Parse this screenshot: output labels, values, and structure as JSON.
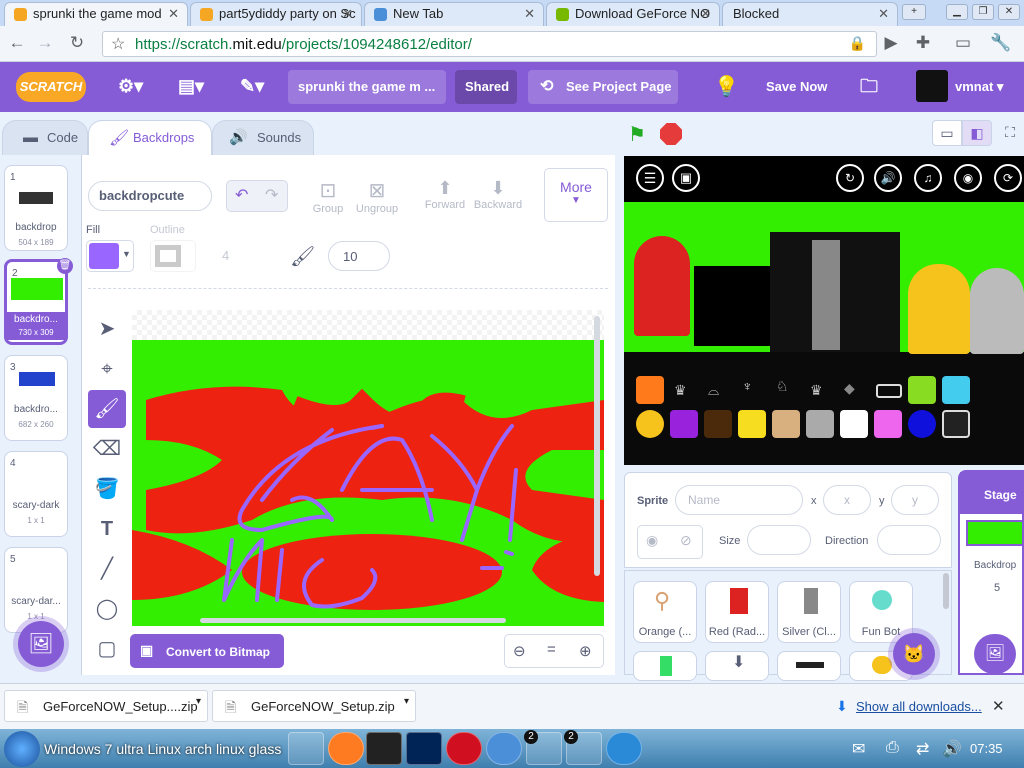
{
  "browser": {
    "tabs": [
      {
        "title": "sprunki the game mod"
      },
      {
        "title": "part5ydiddy party on Sc"
      },
      {
        "title": "New Tab"
      },
      {
        "title": "Download GeForce NO"
      },
      {
        "title": "Blocked"
      }
    ],
    "url_prefix": "https://scratch.",
    "url_domain": "mit.edu",
    "url_path": "/projects/1094248612/editor/"
  },
  "menubar": {
    "logo": "SCRATCH",
    "project_title": "sprunki the game m ...",
    "shared_label": "Shared",
    "see_project_label": "See Project Page",
    "save_label": "Save Now",
    "username": "vmnat"
  },
  "editor_tabs": {
    "code": "Code",
    "backdrops": "Backdrops",
    "sounds": "Sounds"
  },
  "backdrops": [
    {
      "num": "1",
      "name": "backdrop",
      "size": "504 x 189"
    },
    {
      "num": "2",
      "name": "backdro...",
      "size": "730 x 309"
    },
    {
      "num": "3",
      "name": "backdro...",
      "size": "682 x 260"
    },
    {
      "num": "4",
      "name": "scary-dark",
      "size": "1 x 1"
    },
    {
      "num": "5",
      "name": "scary-dar...",
      "size": "1 x 1"
    }
  ],
  "paint": {
    "costume_name": "backdropcute",
    "group": "Group",
    "ungroup": "Ungroup",
    "forward": "Forward",
    "backward": "Backward",
    "more": "More",
    "fill_label": "Fill",
    "outline_label": "Outline",
    "outline_width": "4",
    "brush_size": "10",
    "convert_label": "Convert to Bitmap",
    "fill_color": "#9966ff"
  },
  "sprite_info": {
    "sprite_label": "Sprite",
    "name_placeholder": "Name",
    "x_label": "x",
    "x_placeholder": "x",
    "y_label": "y",
    "y_placeholder": "y",
    "size_label": "Size",
    "direction_label": "Direction"
  },
  "sprites": [
    {
      "name": "Orange (..."
    },
    {
      "name": "Red (Rad..."
    },
    {
      "name": "Silver (Cl..."
    },
    {
      "name": "Fun Bot"
    }
  ],
  "stage_panel": {
    "title": "Stage",
    "backdrops_label": "Backdrop",
    "count": "5"
  },
  "downloads": {
    "items": [
      {
        "name": "GeForceNOW_Setup....zip"
      },
      {
        "name": "GeForceNOW_Setup.zip"
      }
    ],
    "show_all": "Show all downloads..."
  },
  "taskbar": {
    "start_text": "Windows 7 ultra Linux arch linux glass",
    "badge1": "2",
    "badge2": "2",
    "time": "07:35"
  },
  "colors": {
    "accent": "#855cd6",
    "canvas_green": "#33ee00",
    "canvas_red": "#ee2211",
    "scribble": "#9966ff"
  }
}
